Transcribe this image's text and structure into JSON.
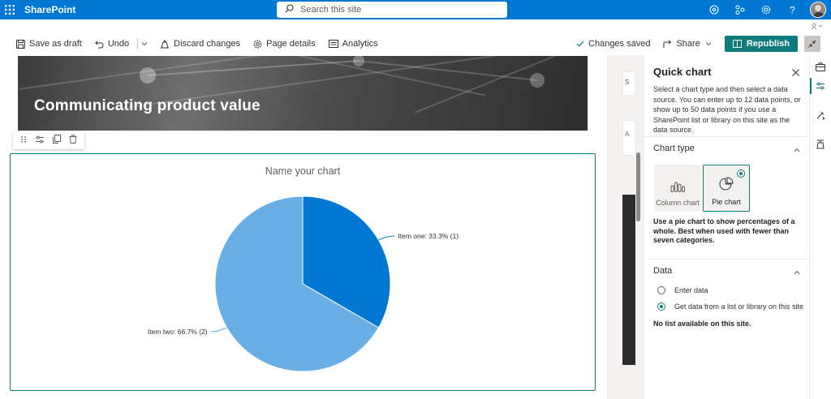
{
  "suite": {
    "brand": "SharePoint",
    "search_placeholder": "Search this site"
  },
  "commands": {
    "save_draft": "Save as draft",
    "undo": "Undo",
    "discard": "Discard changes",
    "page_details": "Page details",
    "analytics": "Analytics",
    "status": "Changes saved",
    "share": "Share",
    "republish": "Republish"
  },
  "hero": {
    "title": "Communicating product value"
  },
  "chart_data": {
    "type": "pie",
    "title": "Name your chart",
    "categories": [
      "Item one",
      "Item two"
    ],
    "values": [
      1,
      2
    ],
    "percentages": [
      33.3,
      66.7
    ],
    "labels": [
      "Item one: 33.3% (1)",
      "Item two: 66.7% (2)"
    ],
    "colors": [
      "#0078d4",
      "#69afe5"
    ]
  },
  "pane": {
    "title": "Quick chart",
    "description": "Select a chart type and then select a data source. You can enter up to 12 data points, or show up to 50 data points if you use a SharePoint list or library on this site as the data source.",
    "chart_type_header": "Chart type",
    "column_chart_label": "Column chart",
    "pie_chart_label": "Pie chart",
    "pie_description": "Use a pie chart to show percentages of a whole. Best when used with fewer than seven categories.",
    "data_header": "Data",
    "enter_data_label": "Enter data",
    "get_data_label": "Get data from a list or library on this site",
    "no_list_message": "No list available on this site."
  },
  "strip": {
    "letter_s": "S",
    "letter_a": "A"
  },
  "colors": {
    "suite_blue": "#0078d4",
    "accent_teal": "#0f7b7b"
  }
}
